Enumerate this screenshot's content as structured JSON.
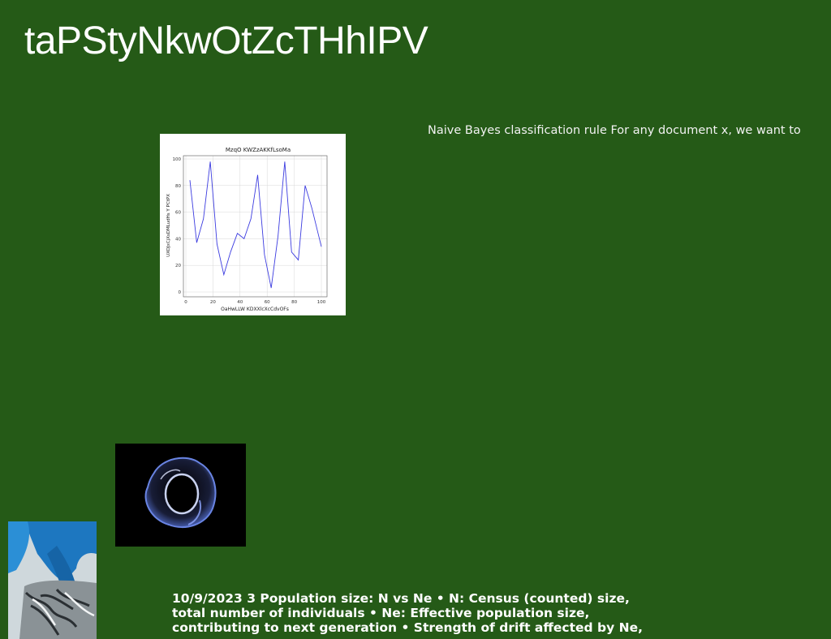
{
  "slide": {
    "title": "taPStyNkwOtZcTHhIPV",
    "body_text": "Naive Bayes classification rule For any document x, we want to",
    "footer_text": "10/9/2023 3 Population size: N vs Ne • N: Census (counted) size, total number of individuals • Ne: Effective population size, contributing to next generation • Strength of drift affected by Ne,"
  },
  "chart_data": {
    "type": "line",
    "title": "MzqO KWZzAKKfLsoMa",
    "xlabel": "OaHwLLW KDXXlcXcCdvOFs",
    "ylabel": "UXOJxCjXsDMLudHs Y PCtPX",
    "xlim": [
      0,
      100
    ],
    "ylim": [
      0,
      100
    ],
    "x_ticks": [
      0,
      20,
      40,
      60,
      80,
      100
    ],
    "y_ticks": [
      0,
      20,
      40,
      60,
      80,
      100
    ],
    "grid": true,
    "line_color": "#3c3ce0",
    "x": [
      3,
      8,
      13,
      18,
      23,
      28,
      33,
      38,
      43,
      48,
      53,
      58,
      63,
      68,
      73,
      78,
      83,
      88,
      93,
      100
    ],
    "y": [
      84,
      37,
      55,
      98,
      36,
      13,
      30,
      44,
      40,
      55,
      88,
      28,
      3,
      42,
      98,
      30,
      24,
      80,
      63,
      34
    ]
  },
  "colors": {
    "background": "#255a17",
    "text": "#ffffff"
  }
}
